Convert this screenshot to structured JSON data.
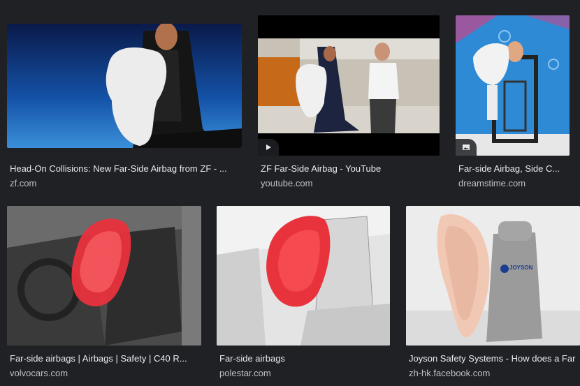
{
  "results": [
    {
      "title": "Head-On Collisions: New Far-Side Airbag from ZF - ...",
      "source": "zf.com"
    },
    {
      "title": "ZF Far-Side Airbag - YouTube",
      "source": "youtube.com",
      "badge_icon": "play-icon"
    },
    {
      "title": "Far-side Airbag, Side C...",
      "source": "dreamstime.com",
      "badge_icon": "image-icon"
    },
    {
      "title": "Far-side airbags | Airbags | Safety | C40 R...",
      "source": "volvocars.com"
    },
    {
      "title": "Far-side airbags",
      "source": "polestar.com"
    },
    {
      "title": "Joyson Safety Systems - How does a Far",
      "source": "zh-hk.facebook.com",
      "seat_logo": "JOYSON"
    }
  ],
  "colors": {
    "background": "#202124",
    "title_text": "#e8eaed",
    "source_text": "#bdc1c6",
    "airbag_red": "#e8323c"
  }
}
